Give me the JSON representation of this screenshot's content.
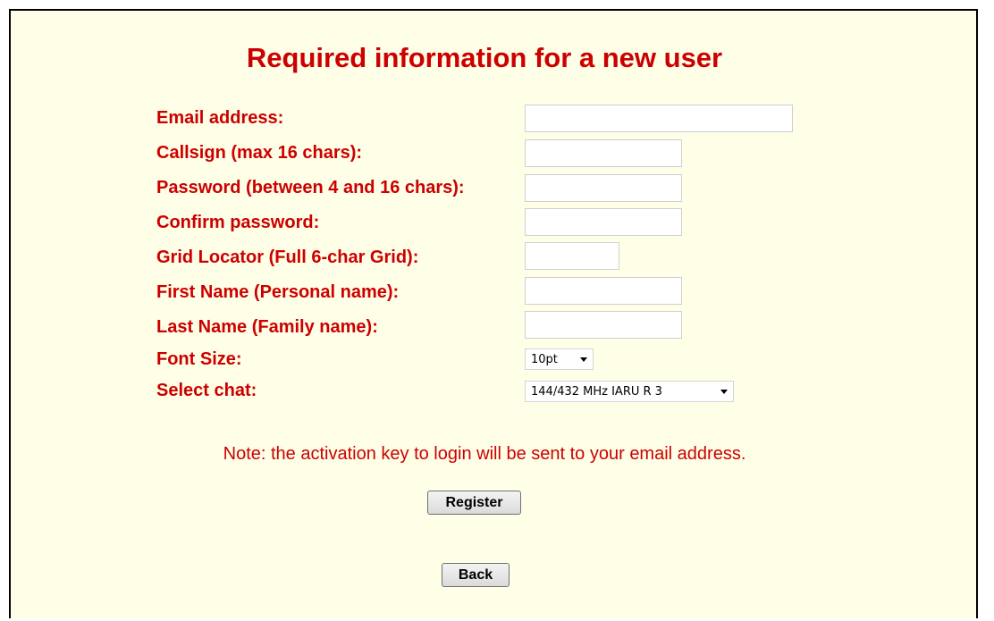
{
  "page": {
    "title": "Required information for a new user",
    "note": "Note: the activation key to login will be sent to your email address."
  },
  "form": {
    "email_label": "Email address:",
    "email_value": "",
    "callsign_label": "Callsign (max 16 chars):",
    "callsign_value": "",
    "password_label": "Password (between 4 and 16 chars):",
    "password_value": "",
    "confirm_label": "Confirm password:",
    "confirm_value": "",
    "grid_label": "Grid Locator (Full 6-char Grid):",
    "grid_value": "",
    "first_name_label": "First Name (Personal name):",
    "first_name_value": "",
    "last_name_label": "Last Name (Family name):",
    "last_name_value": "",
    "font_size_label": "Font Size:",
    "font_size_selected": "10pt",
    "chat_label": "Select chat:",
    "chat_selected": "144/432 MHz IARU R 3"
  },
  "buttons": {
    "register_label": "Register",
    "back_label": "Back"
  },
  "colors": {
    "background": "#ffffe8",
    "label_red": "#cc0000",
    "border": "#000000"
  },
  "icons": {
    "dropdown": "chevron-down-icon"
  }
}
